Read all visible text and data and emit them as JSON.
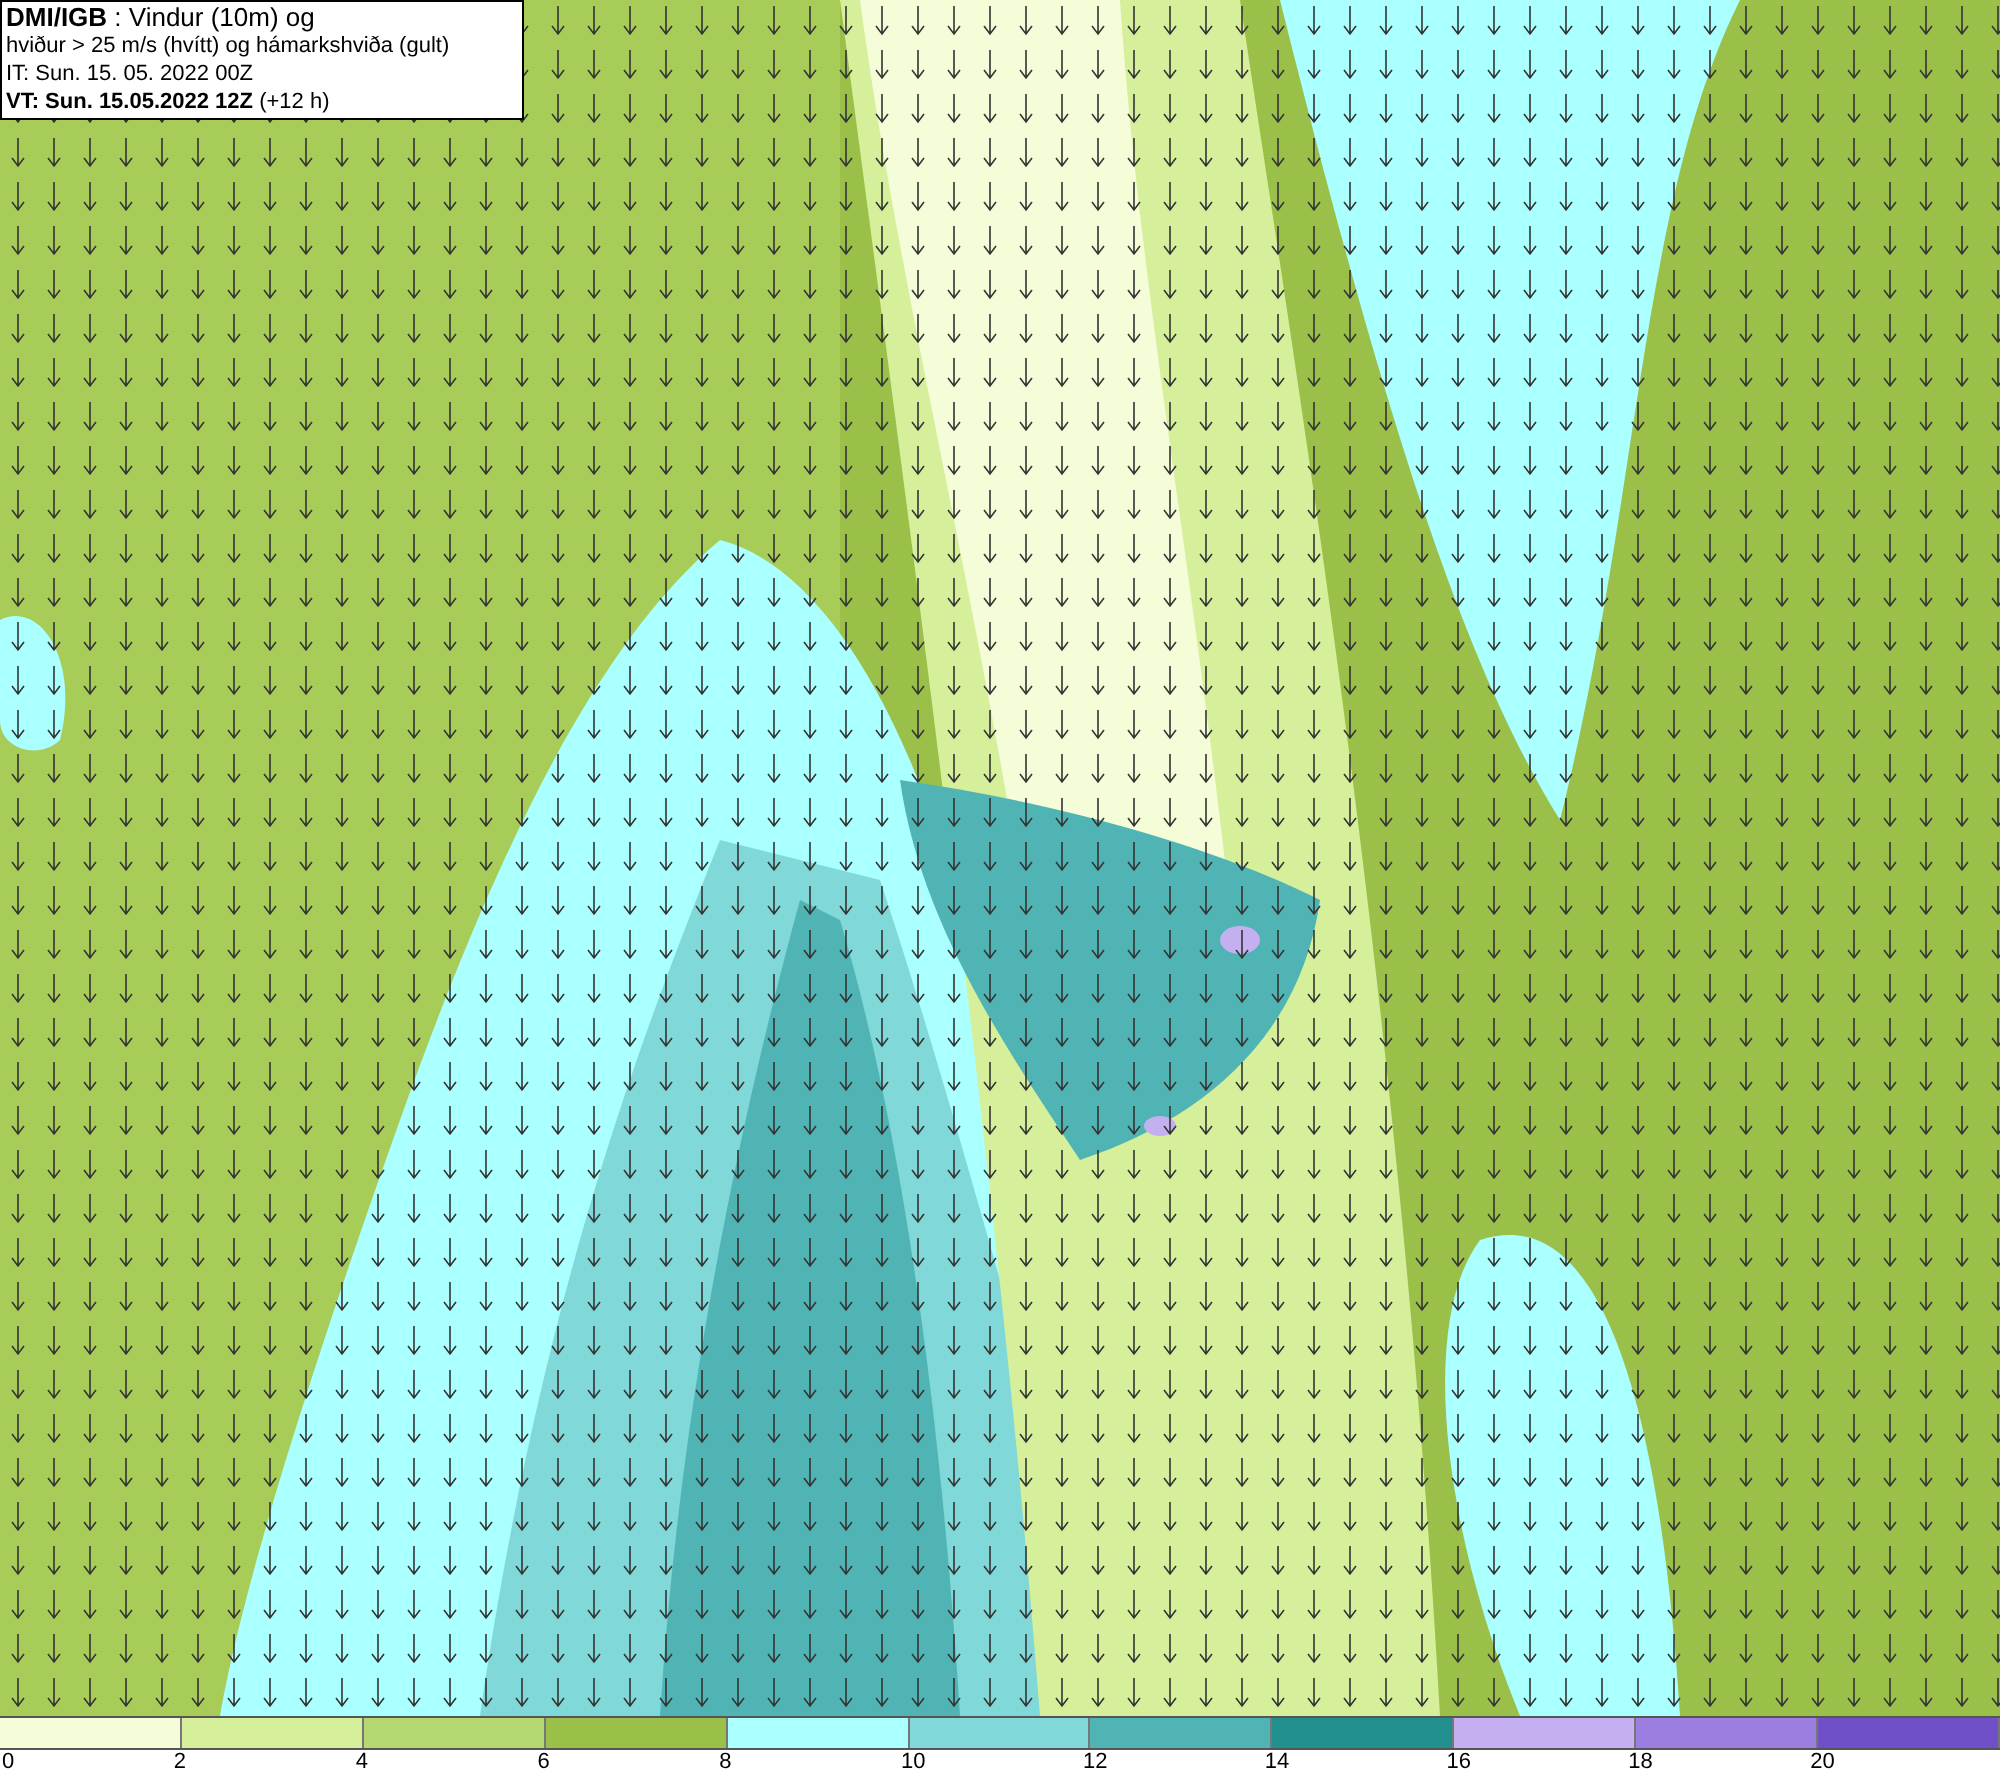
{
  "info_box": {
    "lines": [
      "**DMI/IGB** : Vindur (10m) og",
      "hviður > 25 m/s (hvítt) og hámarkshviða (gult)",
      "IT: Sun. 15. 05. 2022 00Z",
      "**VT: Sun. 15.05.2022 12Z** (+12 h)"
    ]
  },
  "legend": {
    "bins": [
      {
        "color": "#f5fcd8"
      },
      {
        "color": "#d5ef9a"
      },
      {
        "color": "#b5d870"
      },
      {
        "color": "#9ac04a"
      },
      {
        "color": "#aaffff"
      },
      {
        "color": "#80d8d8"
      },
      {
        "color": "#50b4b4"
      },
      {
        "color": "#228f8f"
      },
      {
        "color": "#c4b0f0"
      },
      {
        "color": "#9b7ee0"
      },
      {
        "color": "#7050c8"
      }
    ],
    "labels": [
      "0",
      "2",
      "4",
      "6",
      "8",
      "10",
      "12",
      "14",
      "16",
      "18",
      "20"
    ]
  }
}
